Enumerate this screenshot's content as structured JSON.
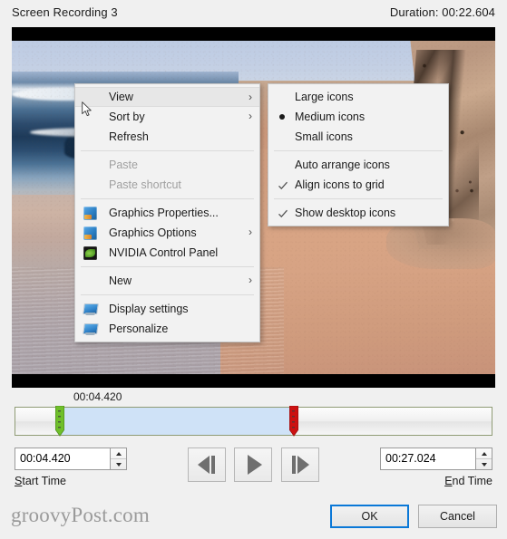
{
  "window": {
    "title": "Screen Recording 3",
    "duration_label": "Duration: 00:22.604"
  },
  "context_menu": {
    "items": [
      {
        "label": "View",
        "icon": "",
        "arrow": "›",
        "state": "hover"
      },
      {
        "label": "Sort by",
        "icon": "",
        "arrow": "›",
        "state": "normal"
      },
      {
        "label": "Refresh",
        "icon": "",
        "arrow": "",
        "state": "normal"
      },
      {
        "label": "Paste",
        "icon": "",
        "arrow": "",
        "state": "disabled"
      },
      {
        "label": "Paste shortcut",
        "icon": "",
        "arrow": "",
        "state": "disabled"
      },
      {
        "label": "Graphics Properties...",
        "icon": "intel-graphics-icon",
        "arrow": "",
        "state": "normal"
      },
      {
        "label": "Graphics Options",
        "icon": "intel-graphics-icon",
        "arrow": "›",
        "state": "normal"
      },
      {
        "label": "NVIDIA Control Panel",
        "icon": "nvidia-icon",
        "arrow": "",
        "state": "normal"
      },
      {
        "label": "New",
        "icon": "",
        "arrow": "›",
        "state": "normal"
      },
      {
        "label": "Display settings",
        "icon": "monitor-icon",
        "arrow": "",
        "state": "normal"
      },
      {
        "label": "Personalize",
        "icon": "monitor-icon",
        "arrow": "",
        "state": "normal"
      }
    ]
  },
  "view_submenu": {
    "items": [
      {
        "label": "Large icons",
        "mark": "none"
      },
      {
        "label": "Medium icons",
        "mark": "radio"
      },
      {
        "label": "Small icons",
        "mark": "none"
      },
      {
        "label": "Auto arrange icons",
        "mark": "none"
      },
      {
        "label": "Align icons to grid",
        "mark": "check"
      },
      {
        "label": "Show desktop icons",
        "mark": "check"
      }
    ]
  },
  "timeline": {
    "tooltip_time": "00:04.420",
    "selection_start_pct": 9,
    "selection_end_pct": 58
  },
  "start_time": {
    "value": "00:04.420",
    "label_prefix": "",
    "label_accel": "S",
    "label_rest": "tart Time"
  },
  "end_time": {
    "value": "00:27.024",
    "label_prefix": "",
    "label_accel": "E",
    "label_rest": "nd Time"
  },
  "transport": {
    "prev_frame": "previous-frame-icon",
    "play": "play-icon",
    "next_frame": "next-frame-icon"
  },
  "footer": {
    "watermark": "groovyPost.com",
    "ok_label": "OK",
    "cancel_label": "Cancel"
  },
  "colors": {
    "selection_blue": "#cfe2f7",
    "handle_start_green": "#6fbf2a",
    "handle_end_red": "#cc1111",
    "focus_blue": "#0a78d7"
  }
}
